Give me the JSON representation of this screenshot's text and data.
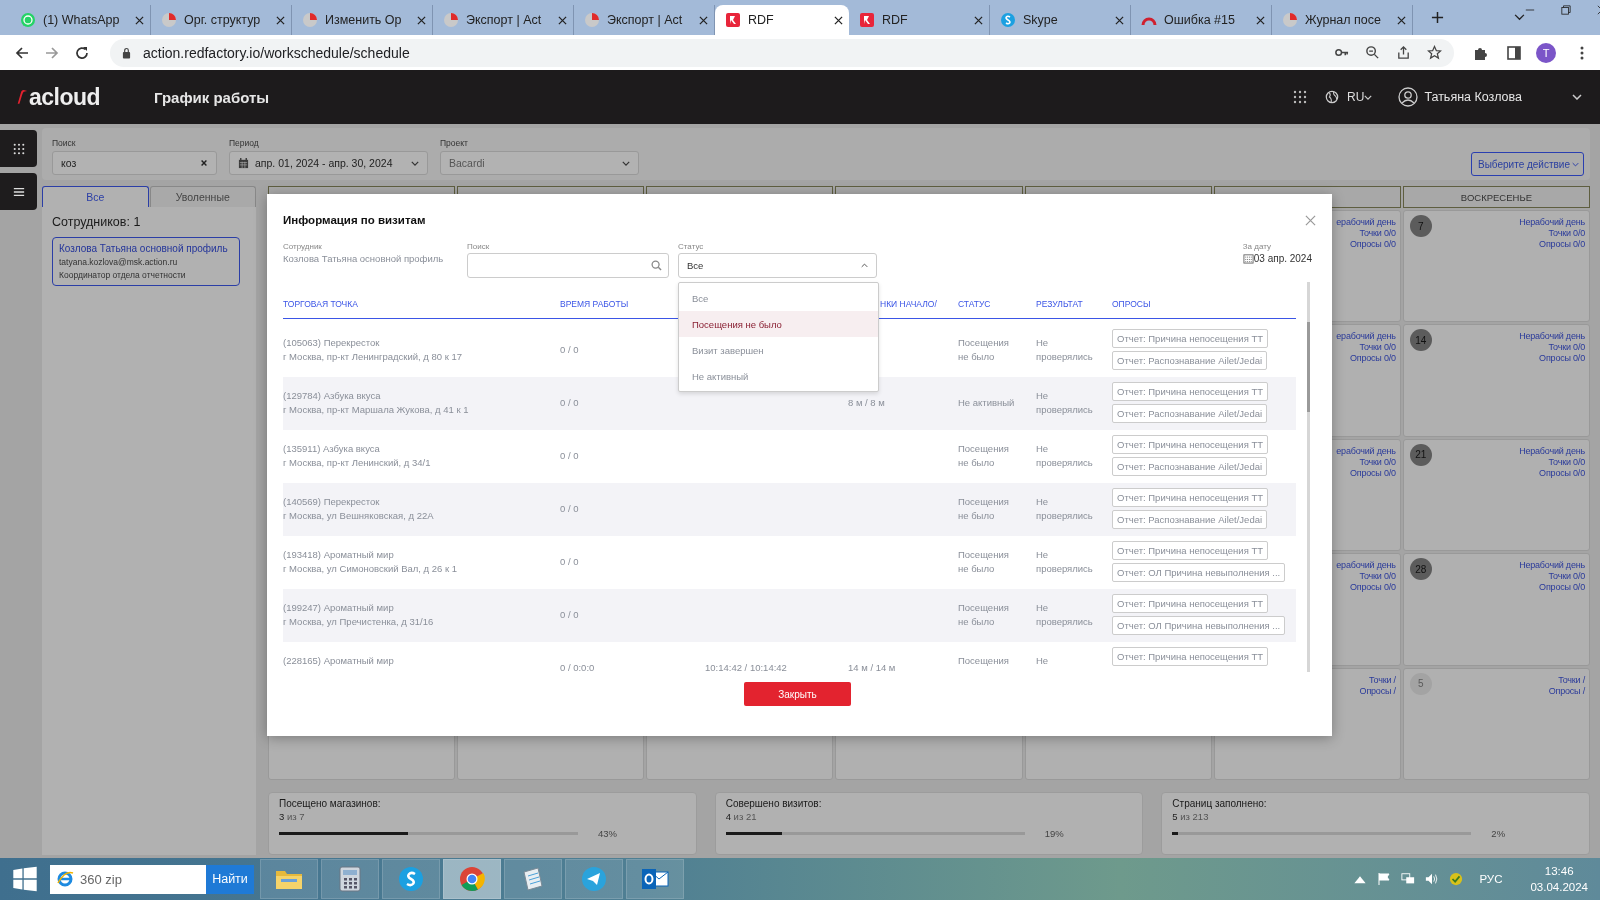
{
  "browser": {
    "tabs": [
      {
        "title": "(1) WhatsApp",
        "kind": "whatsapp",
        "selected": false
      },
      {
        "title": "Орг. структур",
        "kind": "pie",
        "selected": false
      },
      {
        "title": "Изменить Ор",
        "kind": "pie",
        "selected": false
      },
      {
        "title": "Экспорт | Act",
        "kind": "pie",
        "selected": false
      },
      {
        "title": "Экспорт | Act",
        "kind": "pie",
        "selected": false
      },
      {
        "title": "RDF",
        "kind": "rdf",
        "selected": true
      },
      {
        "title": "RDF",
        "kind": "rdf",
        "selected": false
      },
      {
        "title": "Skype",
        "kind": "skype",
        "selected": false
      },
      {
        "title": "Ошибка #15",
        "kind": "gauge",
        "selected": false
      },
      {
        "title": "Журнал посе",
        "kind": "pie",
        "selected": false
      }
    ],
    "url": "action.redfactory.io/workschedule/schedule",
    "avatar": "T"
  },
  "app_header": {
    "logo": "acloud",
    "title": "График работы",
    "language": "RU",
    "user": "Татьяна Козлова"
  },
  "filters": {
    "search": {
      "label": "Поиск",
      "value": "коз"
    },
    "period": {
      "label": "Период",
      "value": "апр. 01, 2024 - апр. 30, 2024"
    },
    "project": {
      "label": "Проект",
      "value": "Bacardi"
    },
    "action_button": "Выберите действие"
  },
  "employees_panel": {
    "tabs": [
      {
        "label": "Все",
        "selected": true
      },
      {
        "label": "Уволенные",
        "selected": false
      }
    ],
    "count": "Сотрудников: 1",
    "employees": [
      {
        "name": "Козлова Татьяна основной профиль",
        "email": "tatyana.kozlova@msk.action.ru",
        "role": "Координатор отдела отчетности",
        "selected": true
      }
    ]
  },
  "calendar": {
    "sunday_heading": "ВОСКРЕСЕНЬЕ",
    "weeks": [
      {
        "saturday": {
          "status": "ерабочий день",
          "points": "Точки 0/0",
          "surveys": "Опросы 0/0"
        },
        "sunday": {
          "day": "7",
          "other_month": false,
          "status": "Нерабочий день",
          "points": "Точки 0/0",
          "surveys": "Опросы 0/0"
        }
      },
      {
        "saturday": {
          "status": "ерабочий день",
          "points": "Точки 0/0",
          "surveys": "Опросы 0/0"
        },
        "sunday": {
          "day": "14",
          "other_month": false,
          "status": "Нерабочий день",
          "points": "Точки 0/0",
          "surveys": "Опросы 0/0"
        }
      },
      {
        "saturday": {
          "status": "ерабочий день",
          "points": "Точки 0/0",
          "surveys": "Опросы 0/0"
        },
        "sunday": {
          "day": "21",
          "other_month": false,
          "status": "Нерабочий день",
          "points": "Точки 0/0",
          "surveys": "Опросы 0/0"
        }
      },
      {
        "saturday": {
          "status": "ерабочий день",
          "points": "Точки 0/0",
          "surveys": "Опросы 0/0"
        },
        "sunday": {
          "day": "28",
          "other_month": false,
          "status": "Нерабочий день",
          "points": "Точки 0/0",
          "surveys": "Опросы 0/0"
        }
      },
      {
        "saturday": {
          "points": "Точки /",
          "surveys": "Опросы /"
        },
        "sunday": {
          "day": "5",
          "other_month": true,
          "points": "Точки /",
          "surveys": "Опросы /"
        }
      }
    ]
  },
  "modal": {
    "title": "Информация по визитам",
    "employee": {
      "label": "Сотрудник",
      "value": "Козлова Татьяна основной профиль"
    },
    "search": {
      "label": "Поиск"
    },
    "status": {
      "label": "Статус",
      "value": "Все",
      "expanded": true,
      "options": [
        {
          "label": "Все",
          "highlighted": false
        },
        {
          "label": "Посещения не было",
          "highlighted": true
        },
        {
          "label": "Визит завершен",
          "highlighted": false
        },
        {
          "label": "Не активный",
          "highlighted": false
        }
      ]
    },
    "date": {
      "label": "За дату",
      "value": "03 апр. 2024"
    },
    "columns": {
      "store": "ТОРГОВАЯ ТОЧКА",
      "work_time": "ВРЕМЯ РАБОТЫ",
      "column_4": "НКИ НАЧАЛО/",
      "status": "СТАТУС",
      "result": "РЕЗУЛЬТАТ",
      "surveys": "ОПРОСЫ"
    },
    "rows": [
      {
        "store": "(105063) Перекресток",
        "address": "г Москва, пр-кт Ленинградский, д 80 к 17",
        "work_time": "0 / 0",
        "status": "Посещения не было",
        "result": "Не проверялись",
        "surveys": [
          "Отчет: Причина непосещения ТТ",
          "Отчет: Распознавание Ailet/Jedai"
        ]
      },
      {
        "store": "(129784) Азбука вкуса",
        "address": "г Москва, пр-кт Маршала Жукова, д 41 к 1",
        "work_time": "0 / 0",
        "column_4": "8 м / 8 м",
        "status": "Не активный",
        "result": "Не проверялись",
        "surveys": [
          "Отчет: Причина непосещения ТТ",
          "Отчет: Распознавание Ailet/Jedai"
        ]
      },
      {
        "store": "(135911) Азбука вкуса",
        "address": "г Москва, пр-кт Ленинский, д 34/1",
        "work_time": "0 / 0",
        "status": "Посещения не было",
        "result": "Не проверялись",
        "surveys": [
          "Отчет: Причина непосещения ТТ",
          "Отчет: Распознавание Ailet/Jedai"
        ]
      },
      {
        "store": "(140569) Перекресток",
        "address": "г Москва, ул Вешняковская, д 22А",
        "work_time": "0 / 0",
        "status": "Посещения не было",
        "result": "Не проверялись",
        "surveys": [
          "Отчет: Причина непосещения ТТ",
          "Отчет: Распознавание Ailet/Jedai"
        ]
      },
      {
        "store": "(193418) Ароматный мир",
        "address": "г Москва, ул Симоновский Вал, д 26 к 1",
        "work_time": "0 / 0",
        "status": "Посещения не было",
        "result": "Не проверялись",
        "surveys": [
          "Отчет: Причина непосещения ТТ",
          "Отчет: ОЛ Причина невыполнения ..."
        ]
      },
      {
        "store": "(199247) Ароматный мир",
        "address": "г Москва, ул Пречистенка, д 31/16",
        "work_time": "0 / 0",
        "status": "Посещения не было",
        "result": "Не проверялись",
        "surveys": [
          "Отчет: Причина непосещения ТТ",
          "Отчет: ОЛ Причина невыполнения ..."
        ]
      },
      {
        "store": "(228165) Ароматный мир",
        "work_time": "0 / 0:0:0",
        "column_3": "10:14:42 / 10:14:42",
        "column_4": "14 м / 14 м",
        "status": "Посещения",
        "result": "Не",
        "surveys": [
          "Отчет: Причина непосещения ТТ"
        ]
      }
    ],
    "close_button": "Закрыть"
  },
  "stats": [
    {
      "label": "Посещено магазинов:",
      "count": "**3** из 7",
      "level": 0.43,
      "percent": "43%"
    },
    {
      "label": "Совершено визитов:",
      "count": "**4** из 21",
      "level": 0.19,
      "percent": "19%"
    },
    {
      "label": "Страниц заполнено:",
      "count": "**5** из 213",
      "level": 0.02,
      "percent": "2%"
    }
  ],
  "taskbar": {
    "search": {
      "value": "360 zip"
    },
    "search_button": "Найти",
    "apps": [
      {
        "kind": "explorer",
        "active": false
      },
      {
        "kind": "calculator",
        "active": false
      },
      {
        "kind": "skype",
        "active": false
      },
      {
        "kind": "chrome",
        "active": true
      },
      {
        "kind": "notes",
        "active": false
      },
      {
        "kind": "telegram",
        "active": false
      },
      {
        "kind": "outlook",
        "active": false
      }
    ],
    "language": "РУС",
    "time": "13:46",
    "date": "03.04.2024"
  }
}
